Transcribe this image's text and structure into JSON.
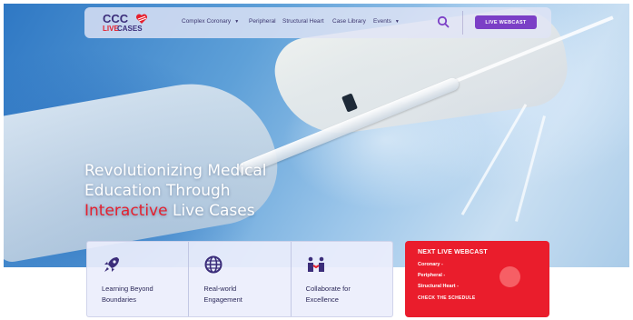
{
  "brand": {
    "logo_top": "CCC",
    "logo_live": "LIVE",
    "logo_cases": "CASES",
    "red": "#e5202e",
    "purple": "#7b3fc6",
    "navy": "#3b2d7a"
  },
  "nav": {
    "items": [
      {
        "label": "Complex Coronary",
        "has_dropdown": true
      },
      {
        "label": "Peripheral",
        "has_dropdown": false
      },
      {
        "label": "Structural Heart",
        "has_dropdown": false
      },
      {
        "label": "Case Library",
        "has_dropdown": false
      },
      {
        "label": "Events",
        "has_dropdown": true
      }
    ],
    "search_icon": "search-icon",
    "cta_label": "LIVE WEBCAST"
  },
  "hero": {
    "line1": "Revolutionizing Medical",
    "line2": "Education Through",
    "line3_highlight": "Interactive",
    "line3_rest": " Live Cases"
  },
  "features": [
    {
      "icon": "rocket-icon",
      "line1": "Learning Beyond",
      "line2": "Boundaries"
    },
    {
      "icon": "globe-icon",
      "line1": "Real-world",
      "line2": "Engagement"
    },
    {
      "icon": "collaborate-icon",
      "line1": "Collaborate for",
      "line2": "Excellence"
    }
  ],
  "next_webcast": {
    "title": "NEXT LIVE WEBCAST",
    "items": [
      "Coronary -",
      "Peripheral -",
      "Structural Heart -"
    ],
    "cta": "CHECK THE SCHEDULE"
  }
}
